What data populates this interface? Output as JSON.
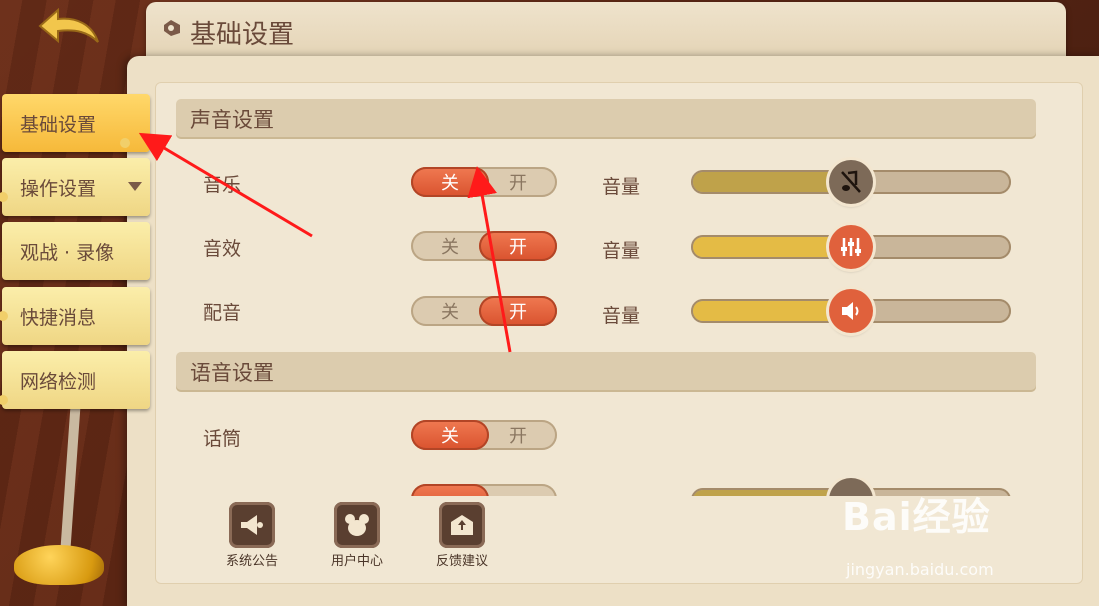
{
  "back_button": {
    "icon": "back-arrow-icon"
  },
  "title": "基础设置",
  "sidebar": {
    "items": [
      {
        "label": "基础设置",
        "active": true
      },
      {
        "label": "操作设置",
        "has_dropdown": true
      },
      {
        "label": "观战 · 录像"
      },
      {
        "label": "快捷消息"
      },
      {
        "label": "网络检测"
      }
    ]
  },
  "sections": {
    "sound": {
      "header": "声音设置",
      "rows": [
        {
          "label": "音乐",
          "off": "关",
          "on": "开",
          "state": "off",
          "volume_label": "音量",
          "volume": 0.47,
          "knob_icon": "music-muted-icon"
        },
        {
          "label": "音效",
          "off": "关",
          "on": "开",
          "state": "on",
          "volume_label": "音量",
          "volume": 0.47,
          "knob_icon": "equalizer-icon"
        },
        {
          "label": "配音",
          "off": "关",
          "on": "开",
          "state": "on",
          "volume_label": "音量",
          "volume": 0.47,
          "knob_icon": "speaker-icon"
        }
      ]
    },
    "voice": {
      "header": "语音设置",
      "rows": [
        {
          "label": "话筒",
          "off": "关",
          "on": "开",
          "state": "off"
        }
      ]
    }
  },
  "bottom_buttons": [
    {
      "label": "系统公告",
      "icon": "megaphone-icon"
    },
    {
      "label": "用户中心",
      "icon": "mouse-head-icon"
    },
    {
      "label": "反馈建议",
      "icon": "mail-upload-icon"
    }
  ],
  "watermark": {
    "brand": "Bai经验",
    "url": "jingyan.baidu.com"
  },
  "colors": {
    "accent": "#e0613c",
    "slider_fill": "#e4bb45",
    "panel": "#ede0c6",
    "text": "#6a4a3a"
  }
}
